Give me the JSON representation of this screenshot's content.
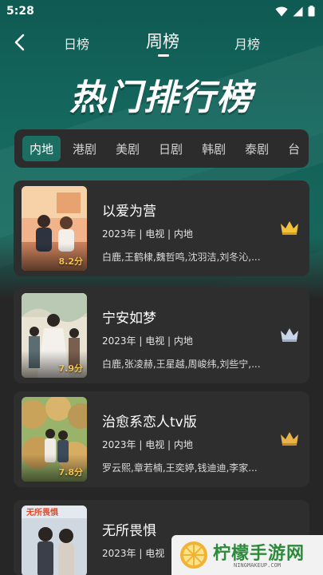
{
  "status_bar": {
    "time": "5:28"
  },
  "nav": {
    "tabs": [
      {
        "label": "日榜"
      },
      {
        "label": "周榜"
      },
      {
        "label": "月榜"
      }
    ],
    "active_tab": "周榜"
  },
  "hero": {
    "title": "热门排行榜"
  },
  "categories": {
    "active": "内地",
    "items": [
      "内地",
      "港剧",
      "美剧",
      "日剧",
      "韩剧",
      "泰剧",
      "台"
    ]
  },
  "rankings": [
    {
      "title": "以爱为营",
      "meta": "2023年 | 电视 | 内地",
      "cast": "白鹿,王鹤棣,魏哲鸣,沈羽洁,刘冬沁,...",
      "rating": "8.2分",
      "crown_color": "#f2c23a"
    },
    {
      "title": "宁安如梦",
      "meta": "2023年 | 电视 | 内地",
      "cast": "白鹿,张凌赫,王星越,周峻纬,刘些宁,...",
      "rating": "7.9分",
      "crown_color": "#c9d6ea"
    },
    {
      "title": "治愈系恋人tv版",
      "meta": "2023年 | 电视 | 内地",
      "cast": "罗云熙,章若楠,王奕婷,钱迪迪,李家...",
      "rating": "7.8分",
      "crown_color": "#e8b44a"
    },
    {
      "title": "无所畏惧",
      "meta": "2023年 | 电视",
      "cast": "",
      "rating": "",
      "crown_color": ""
    }
  ],
  "watermark": {
    "main": "柠檬手游网",
    "sub": "NINGMAKEUP.COM"
  },
  "colors": {
    "accent": "#1d6e62",
    "card_bg": "#2e2e2e",
    "rating": "#f3c24b"
  }
}
